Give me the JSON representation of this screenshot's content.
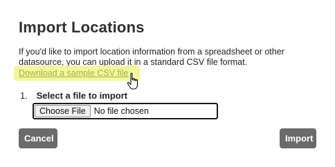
{
  "dialog": {
    "title": "Import Locations",
    "description": "If you'd like to import location information from a spreadsheet or other datasource, you can upload it in a standard CSV file format.",
    "sample_link": "Download a sample CSV file",
    "steps": [
      {
        "number": "1.",
        "label": "Select a file to import",
        "file_button_label": "Choose File",
        "file_status": "No file chosen"
      }
    ],
    "cancel_label": "Cancel",
    "import_label": "Import"
  },
  "colors": {
    "link": "#9ab54a",
    "highlight": "#f3f58a",
    "button_bg": "#6b6b6b",
    "button_text": "#ffffff"
  },
  "icons": {
    "cursor": "hand-pointer-icon"
  }
}
